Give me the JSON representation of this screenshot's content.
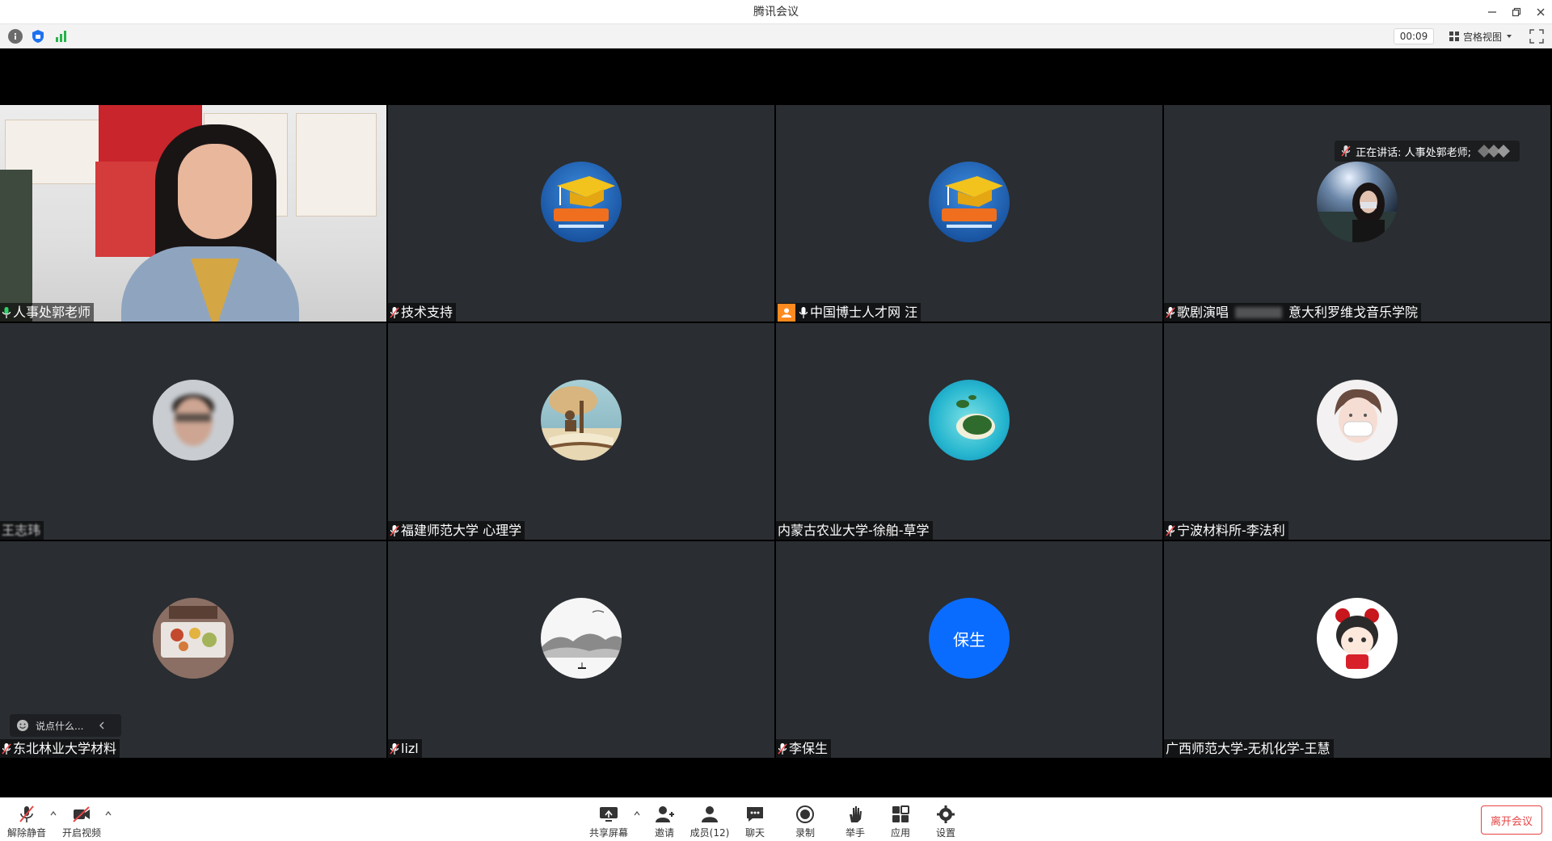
{
  "window": {
    "title": "腾讯会议",
    "controls": [
      "minimize-icon",
      "restore-icon",
      "close-icon"
    ]
  },
  "infobar": {
    "icons": [
      "info-icon",
      "security-shield-icon",
      "signal-icon"
    ],
    "timer": "00:09",
    "view_mode": "宫格视图"
  },
  "speaking_indicator": "正在讲话: 人事处郭老师;",
  "tiles": [
    {
      "name": "人事处郭老师",
      "avatar_text": "",
      "avatar_kind": "video",
      "mic": "on",
      "active": true
    },
    {
      "name": "技术支持",
      "avatar_text": "",
      "avatar_kind": "logo-boshi",
      "mic": "muted"
    },
    {
      "name": "中国博士人才网 汪",
      "avatar_text": "",
      "avatar_kind": "logo-boshi",
      "mic": "on",
      "host_badge": true
    },
    {
      "name": "歌剧演唱",
      "name_tail": "意大利罗维戈音乐学院",
      "avatar_text": "",
      "avatar_kind": "photo-girl-night",
      "mic": "muted"
    },
    {
      "name": "王志玮",
      "avatar_text": "",
      "avatar_kind": "photo-blurred-man",
      "mic": "none"
    },
    {
      "name": "福建师范大学 心理学",
      "avatar_text": "",
      "avatar_kind": "photo-book-tree",
      "mic": "muted"
    },
    {
      "name": "内蒙古农业大学-徐舶-草学",
      "avatar_text": "",
      "avatar_kind": "photo-island",
      "mic": "none"
    },
    {
      "name": "宁波材料所-李法利",
      "avatar_text": "",
      "avatar_kind": "photo-boy-mask",
      "mic": "muted"
    },
    {
      "name": "东北林业大学材料",
      "avatar_text": "",
      "avatar_kind": "photo-food",
      "mic": "muted"
    },
    {
      "name": "lizl",
      "avatar_text": "",
      "avatar_kind": "photo-ink-landscape",
      "mic": "muted"
    },
    {
      "name": "李保生",
      "avatar_text": "保生",
      "avatar_kind": "initials",
      "mic": "muted"
    },
    {
      "name": "广西师范大学-无机化学-王慧",
      "avatar_text": "",
      "avatar_kind": "photo-cartoon-girl",
      "mic": "none"
    }
  ],
  "chat_input": {
    "placeholder": "说点什么..."
  },
  "toolbar": {
    "unmute": "解除静音",
    "start_video": "开启视频",
    "share_screen": "共享屏幕",
    "invite": "邀请",
    "members": "成员(12)",
    "chat": "聊天",
    "record": "录制",
    "raise_hand": "举手",
    "apps": "应用",
    "settings": "设置",
    "leave": "离开会议"
  },
  "colors": {
    "tile_bg": "#2a2d31",
    "active_border": "#20c05c",
    "initials_avatar": "#0a6cff",
    "leave_red": "#e64545"
  }
}
